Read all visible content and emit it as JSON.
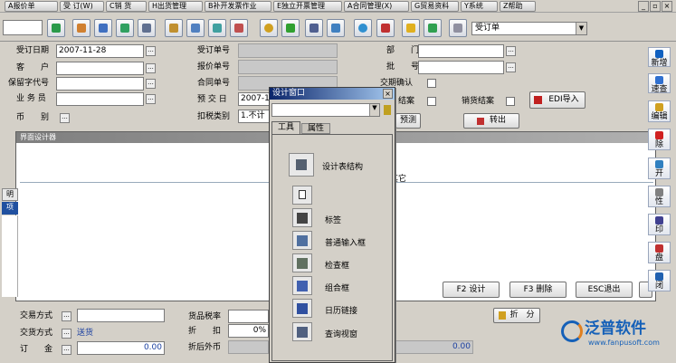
{
  "menu": [
    "A报价单",
    "受 订(W)",
    "C销 货",
    "H出货管理",
    "B补开发票作业",
    "E独立开票管理",
    "A合同管理(X)",
    "G贸易资料",
    "Y系统",
    "Z帮助"
  ],
  "window_controls": [
    "_",
    "▫",
    "×"
  ],
  "toolbar": {
    "doc_type": "受订单"
  },
  "form": {
    "order_date_label": "受订日期",
    "order_date": "2007-11-28",
    "customer_label": "客　　户",
    "confidential_label": "保留字代号",
    "salesperson_label": "业 务 员",
    "currency_label": "币　　别",
    "order_no_label": "受订单号",
    "quote_no_label": "报价单号",
    "contract_no_label": "合同单号",
    "delivery_date_label": "预 交 日",
    "delivery_date": "2007-1",
    "tax_type_label": "扣税类别",
    "tax_type": "1.不计",
    "dept_label": "部　　门",
    "batch_label": "批　　号",
    "confirm_label": "交期确认",
    "close_label": "结案",
    "sales_close_label": "销货结案",
    "edi_button": "EDI导入",
    "forecast_button": "预测",
    "transfer_button": "转出"
  },
  "designer": {
    "title": "界面设计器",
    "hidden_label": "其它",
    "tab_prefix": "明",
    "row_prefix": "项",
    "f2": "F2 设计",
    "f3": "F3 删除",
    "esc": "ESC退出"
  },
  "popup": {
    "title": "设计窗口",
    "tabs": [
      "工具",
      "属性"
    ],
    "tools": [
      "设计表结构",
      "标签",
      "普通输入框",
      "检查框",
      "组合框",
      "日历链接",
      "查询视窗"
    ]
  },
  "footer": {
    "trade_label": "交易方式",
    "delivery_label": "交货方式",
    "delivery_value": "送货",
    "deposit_label": "订　　金",
    "deposit_value": "0.00",
    "tax_rate_label": "货品税率",
    "discount_label": "折　　扣",
    "discount_value": "0%",
    "foreign_label": "折后外币",
    "foreign_value": "0.00",
    "split_button": "折　分"
  },
  "sidebar": [
    {
      "label": "新增",
      "color": "#1060c0"
    },
    {
      "label": "速查",
      "color": "#3070d0"
    },
    {
      "label": "编辑",
      "color": "#d0a020"
    },
    {
      "label": "除",
      "color": "#d02020"
    },
    {
      "label": "开",
      "color": "#3080c0"
    },
    {
      "label": "性",
      "color": "#808080"
    },
    {
      "label": "印",
      "color": "#404090"
    },
    {
      "label": "盘",
      "color": "#c03030"
    },
    {
      "label": "闭",
      "color": "#2060b0"
    }
  ],
  "logo": {
    "text": "泛普软件",
    "url": "www.fanpusoft.com",
    "color": "#1560b8"
  }
}
